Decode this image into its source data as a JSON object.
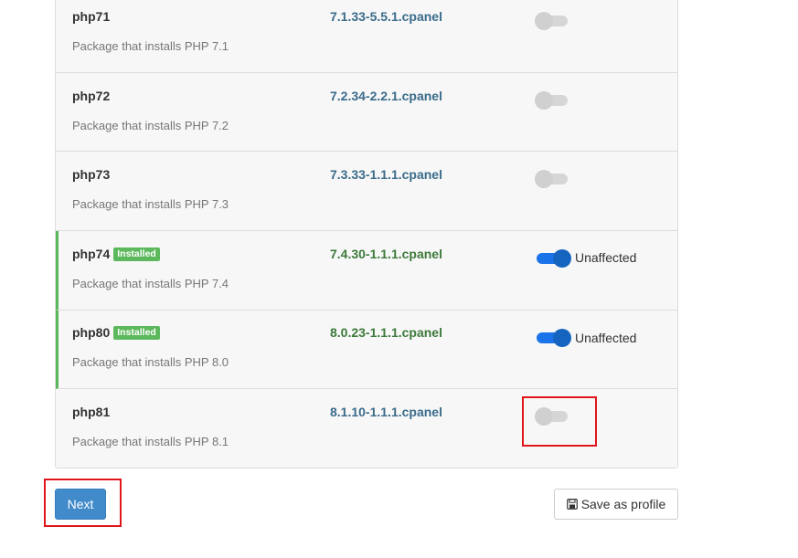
{
  "packages": [
    {
      "name": "php71",
      "description": "Package that installs PHP 7.1",
      "version": "7.1.33-5.5.1.cpanel",
      "installed": false,
      "enabled": false,
      "status": ""
    },
    {
      "name": "php72",
      "description": "Package that installs PHP 7.2",
      "version": "7.2.34-2.2.1.cpanel",
      "installed": false,
      "enabled": false,
      "status": ""
    },
    {
      "name": "php73",
      "description": "Package that installs PHP 7.3",
      "version": "7.3.33-1.1.1.cpanel",
      "installed": false,
      "enabled": false,
      "status": ""
    },
    {
      "name": "php74",
      "description": "Package that installs PHP 7.4",
      "version": "7.4.30-1.1.1.cpanel",
      "installed": true,
      "enabled": true,
      "status": "Unaffected"
    },
    {
      "name": "php80",
      "description": "Package that installs PHP 8.0",
      "version": "8.0.23-1.1.1.cpanel",
      "installed": true,
      "enabled": true,
      "status": "Unaffected"
    },
    {
      "name": "php81",
      "description": "Package that installs PHP 8.1",
      "version": "8.1.10-1.1.1.cpanel",
      "installed": false,
      "enabled": false,
      "status": ""
    }
  ],
  "installed_badge": "Installed",
  "buttons": {
    "next_label": "Next",
    "save_profile_label": "Save as profile"
  },
  "icons": {
    "save": "floppy-disk-icon"
  },
  "colors": {
    "installed_accent": "#5cb85c",
    "toggle_on": "#1a73e8",
    "primary_button": "#428bca",
    "highlight": "#e0161b"
  }
}
